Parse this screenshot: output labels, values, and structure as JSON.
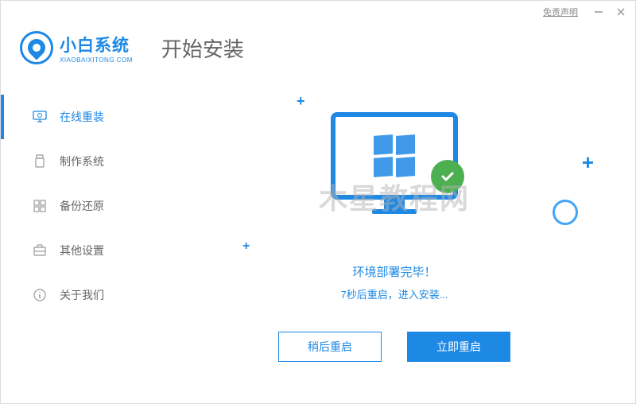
{
  "titlebar": {
    "disclaimer": "免责声明"
  },
  "logo": {
    "title": "小白系统",
    "subtitle": "XIAOBAIXITONG.COM"
  },
  "page_title": "开始安装",
  "sidebar": {
    "items": [
      {
        "label": "在线重装",
        "icon": "monitor-reinstall-icon",
        "active": true
      },
      {
        "label": "制作系统",
        "icon": "usb-icon",
        "active": false
      },
      {
        "label": "备份还原",
        "icon": "grid-icon",
        "active": false
      },
      {
        "label": "其他设置",
        "icon": "briefcase-icon",
        "active": false
      },
      {
        "label": "关于我们",
        "icon": "info-icon",
        "active": false
      }
    ]
  },
  "main": {
    "watermark": "木星教程网",
    "status_text": "环境部署完毕！",
    "status_sub": "7秒后重启，进入安装...",
    "btn_later": "稍后重启",
    "btn_now": "立即重启"
  },
  "colors": {
    "primary": "#1e88e5",
    "success": "#4caf50"
  }
}
